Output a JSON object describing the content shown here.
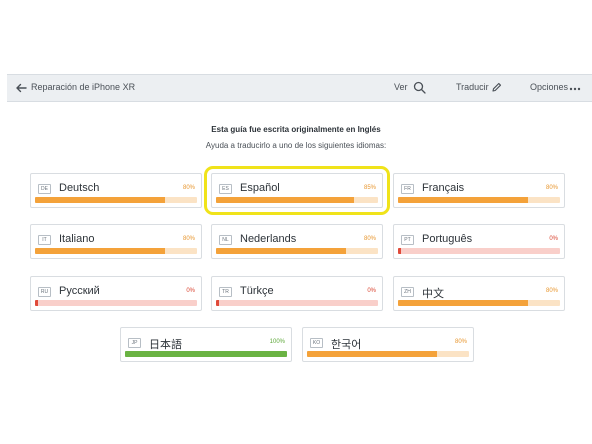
{
  "toolbar": {
    "breadcrumb": "Reparación de iPhone XR",
    "view_label": "Ver",
    "translate_label": "Traducir",
    "options_label": "Opciones"
  },
  "heading": "Esta guía fue escrita originalmente en Inglés",
  "subheading": "Ayuda a traducirlo a uno de los siguientes idiomas:",
  "colors": {
    "orange_fill": "#f4a23a",
    "orange_track": "#fbe3c5",
    "red_fill": "#e04a3a",
    "red_track": "#f9cfca",
    "green_fill": "#6ab343",
    "green_track": "#cfe8c2",
    "orange_text": "#e8962e",
    "red_text": "#d9432f",
    "green_text": "#5ea83a",
    "highlight": "#f0e31a"
  },
  "languages": [
    {
      "code": "DE",
      "name": "Deutsch",
      "percent_label": "80%",
      "progress": 0.8,
      "status": "orange"
    },
    {
      "code": "ES",
      "name": "Español",
      "percent_label": "85%",
      "progress": 0.85,
      "status": "orange",
      "highlighted": true
    },
    {
      "code": "FR",
      "name": "Français",
      "percent_label": "80%",
      "progress": 0.8,
      "status": "orange"
    },
    {
      "code": "IT",
      "name": "Italiano",
      "percent_label": "80%",
      "progress": 0.8,
      "status": "orange"
    },
    {
      "code": "NL",
      "name": "Nederlands",
      "percent_label": "80%",
      "progress": 0.8,
      "status": "orange"
    },
    {
      "code": "PT",
      "name": "Português",
      "percent_label": "0%",
      "progress": 0.02,
      "status": "red"
    },
    {
      "code": "RU",
      "name": "Русский",
      "percent_label": "0%",
      "progress": 0.02,
      "status": "red"
    },
    {
      "code": "TR",
      "name": "Türkçe",
      "percent_label": "0%",
      "progress": 0.02,
      "status": "red"
    },
    {
      "code": "ZH",
      "name": "中文",
      "percent_label": "80%",
      "progress": 0.8,
      "status": "orange"
    },
    {
      "code": "JP",
      "name": "日本語",
      "percent_label": "100%",
      "progress": 1.0,
      "status": "green"
    },
    {
      "code": "KO",
      "name": "한국어",
      "percent_label": "80%",
      "progress": 0.8,
      "status": "orange"
    }
  ]
}
